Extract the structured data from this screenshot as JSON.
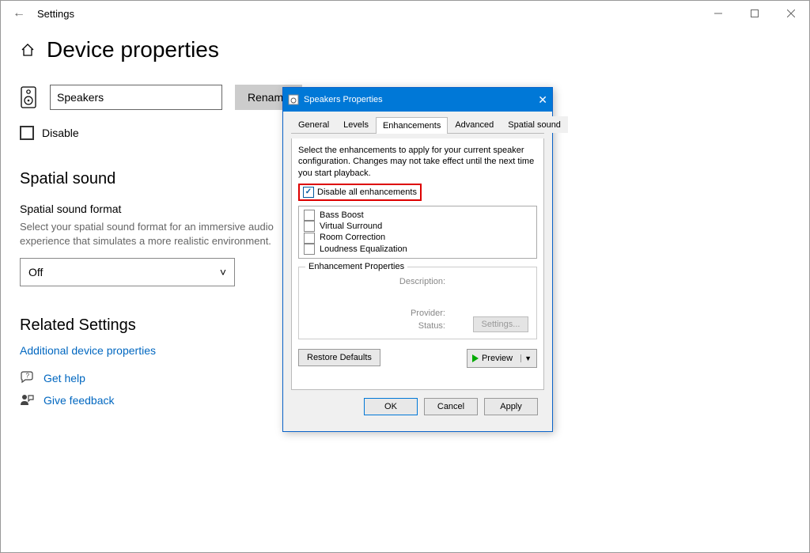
{
  "window": {
    "title": "Settings"
  },
  "page": {
    "title": "Device properties"
  },
  "device": {
    "name": "Speakers",
    "rename": "Rename",
    "disable": "Disable"
  },
  "spatial": {
    "heading": "Spatial sound",
    "format_label": "Spatial sound format",
    "help": "Select your spatial sound format for an immersive audio experience that simulates a more realistic environment.",
    "value": "Off"
  },
  "related": {
    "heading": "Related Settings",
    "link": "Additional device properties"
  },
  "footer": {
    "help": "Get help",
    "feedback": "Give feedback"
  },
  "dialog": {
    "title": "Speakers Properties",
    "tabs": {
      "general": "General",
      "levels": "Levels",
      "enhancements": "Enhancements",
      "advanced": "Advanced",
      "spatial": "Spatial sound"
    },
    "desc": "Select the enhancements to apply for your current speaker configuration. Changes may not take effect until the next time you start playback.",
    "disable_all": "Disable all enhancements",
    "items": [
      "Bass Boost",
      "Virtual Surround",
      "Room Correction",
      "Loudness Equalization"
    ],
    "props": {
      "legend": "Enhancement Properties",
      "description": "Description:",
      "provider": "Provider:",
      "status": "Status:",
      "settings": "Settings..."
    },
    "restore": "Restore Defaults",
    "preview": "Preview",
    "ok": "OK",
    "cancel": "Cancel",
    "apply": "Apply"
  }
}
